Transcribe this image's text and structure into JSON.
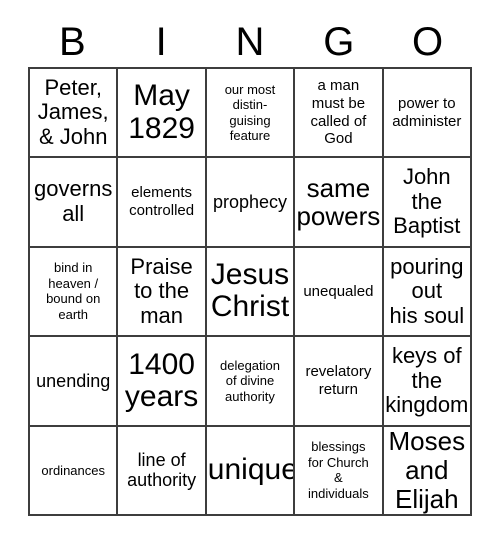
{
  "card": {
    "title": "BINGO",
    "header_letters": [
      "B",
      "I",
      "N",
      "G",
      "O"
    ],
    "columns": 5,
    "rows": 5,
    "border_color": "#3d3d3d",
    "background_color": "#ffffff",
    "text_color": "#000000",
    "free_space": false,
    "cells": [
      {
        "text": "Peter,\nJames,\n& John",
        "size": "lg"
      },
      {
        "text": "May\n1829",
        "size": "xxl"
      },
      {
        "text": "our most\ndistin-\nguising\nfeature",
        "size": "xs"
      },
      {
        "text": "a man\nmust be\ncalled of\nGod",
        "size": "sm"
      },
      {
        "text": "power to\nadminister",
        "size": "sm"
      },
      {
        "text": "governs\nall",
        "size": "lg"
      },
      {
        "text": "elements\ncontrolled",
        "size": "sm"
      },
      {
        "text": "prophecy",
        "size": "md"
      },
      {
        "text": "same\npowers",
        "size": "xl"
      },
      {
        "text": "John\nthe\nBaptist",
        "size": "lg"
      },
      {
        "text": "bind in\nheaven /\nbound on\nearth",
        "size": "xs"
      },
      {
        "text": "Praise\nto the\nman",
        "size": "lg"
      },
      {
        "text": "Jesus\nChrist",
        "size": "xxl"
      },
      {
        "text": "unequaled",
        "size": "sm"
      },
      {
        "text": "pouring\nout\nhis soul",
        "size": "lg"
      },
      {
        "text": "unending",
        "size": "md"
      },
      {
        "text": "1400\nyears",
        "size": "xxl"
      },
      {
        "text": "delegation\nof divine\nauthority",
        "size": "xs"
      },
      {
        "text": "revelatory\nreturn",
        "size": "sm"
      },
      {
        "text": "keys of\nthe\nkingdom",
        "size": "lg"
      },
      {
        "text": "ordinances",
        "size": "xs"
      },
      {
        "text": "line of\nauthority",
        "size": "md"
      },
      {
        "text": "unique",
        "size": "xxl"
      },
      {
        "text": "blessings\nfor Church\n&\nindividuals",
        "size": "xs"
      },
      {
        "text": "Moses\nand\nElijah",
        "size": "xl"
      }
    ]
  }
}
